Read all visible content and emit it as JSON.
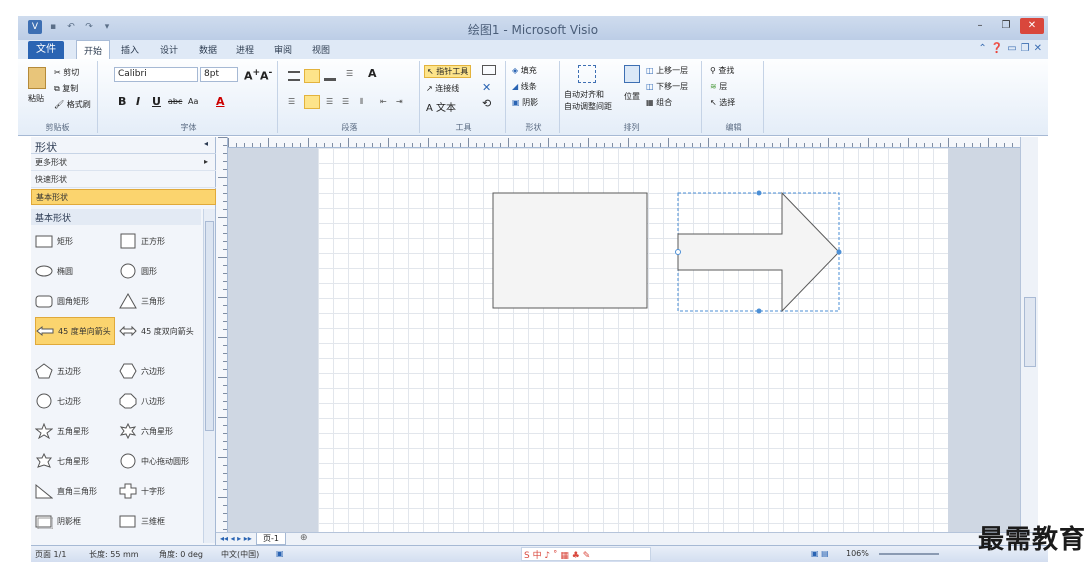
{
  "window": {
    "title": "绘图1 - Microsoft Visio"
  },
  "tabs": {
    "file": "文件",
    "items": [
      "开始",
      "插入",
      "设计",
      "数据",
      "进程",
      "审阅",
      "视图"
    ],
    "active": "开始"
  },
  "ribbon": {
    "clipboard": {
      "paste": "粘贴",
      "cut": "剪切",
      "copy": "复制",
      "format_painter": "格式刷",
      "label": "剪贴板"
    },
    "font": {
      "name": "Calibri",
      "size": "8pt",
      "label": "字体",
      "bold": "B",
      "italic": "I",
      "underline": "U",
      "strike": "abc",
      "case": "Aa"
    },
    "paragraph": {
      "label": "段落"
    },
    "tools": {
      "pointer": "指针工具",
      "connector": "连接线",
      "text": "A 文本",
      "label": "工具"
    },
    "shape": {
      "fill": "填充",
      "line": "线条",
      "shadow": "阴影",
      "label": "形状"
    },
    "arrange": {
      "align": "自动对齐和",
      "space": "自动调整间距",
      "position": "位置",
      "front": "上移一层",
      "back": "下移一层",
      "group": "组合",
      "label": "排列"
    },
    "edit": {
      "find": "查找",
      "layer": "层",
      "select": "选择",
      "label": "编辑"
    }
  },
  "shapes_pane": {
    "title": "形状",
    "more": "更多形状",
    "quick": "快速形状",
    "basic_tab": "基本形状",
    "basic_head": "基本形状",
    "items": [
      "矩形",
      "正方形",
      "椭圆",
      "圆形",
      "圆角矩形",
      "三角形",
      "45 度单向箭头",
      "45 度双向箭头",
      "五边形",
      "六边形",
      "七边形",
      "八边形",
      "五角星形",
      "六角星形",
      "七角星形",
      "中心拖动圆形",
      "直角三角形",
      "十字形",
      "阴影框",
      "三维框"
    ]
  },
  "page_tab": "页-1",
  "status": {
    "page": "页面 1/1",
    "width": "长度: 55 mm",
    "angle": "角度: 0 deg",
    "lang": "中文(中国)",
    "zoom": "106%"
  },
  "watermark": "最需教育",
  "colors": {
    "file_tab": "#2a64b3",
    "selection": "#fbd46e",
    "close": "#d9473c"
  }
}
